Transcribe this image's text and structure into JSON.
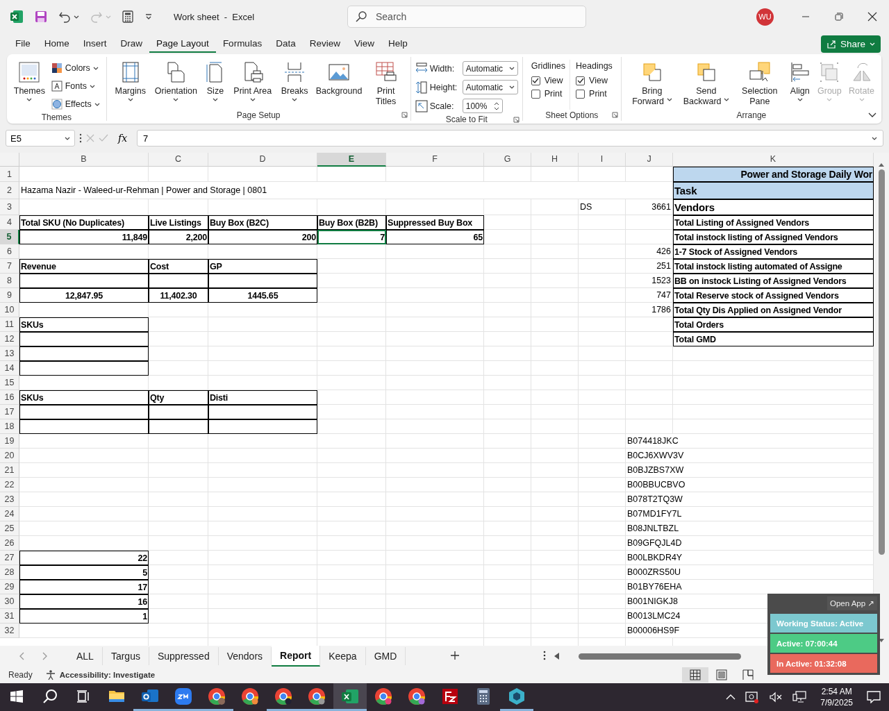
{
  "title_bar": {
    "title": "Work sheet  -  Excel",
    "search": {
      "placeholder": "Search"
    },
    "avatar": "WU"
  },
  "menu": {
    "tabs": [
      {
        "label": "File",
        "selected": false
      },
      {
        "label": "Home",
        "selected": false
      },
      {
        "label": "Insert",
        "selected": false
      },
      {
        "label": "Draw",
        "selected": false
      },
      {
        "label": "Page Layout",
        "selected": true
      },
      {
        "label": "Formulas",
        "selected": false
      },
      {
        "label": "Data",
        "selected": false
      },
      {
        "label": "Review",
        "selected": false
      },
      {
        "label": "View",
        "selected": false
      },
      {
        "label": "Help",
        "selected": false
      }
    ],
    "share": "Share"
  },
  "ribbon": {
    "groups": [
      {
        "label": "Themes",
        "launcher": false,
        "items": [
          {
            "kind": "large",
            "label": "Themes",
            "dropdown": true,
            "disabled": false
          },
          {
            "kind": "small",
            "label": "Colors",
            "dropdown": true,
            "disabled": false
          },
          {
            "kind": "small",
            "label": "Fonts",
            "dropdown": true,
            "disabled": false
          },
          {
            "kind": "small",
            "label": "Effects",
            "dropdown": true,
            "disabled": false
          }
        ]
      },
      {
        "label": "Page Setup",
        "launcher": true,
        "items": [
          {
            "kind": "large",
            "label": "Margins",
            "dropdown": true,
            "disabled": false
          },
          {
            "kind": "large",
            "label": "Orientation",
            "dropdown": true,
            "disabled": false
          },
          {
            "kind": "large",
            "label": "Size",
            "dropdown": true,
            "disabled": false
          },
          {
            "kind": "large",
            "label": "Print Area",
            "dropdown": true,
            "disabled": false
          },
          {
            "kind": "large",
            "label": "Breaks",
            "dropdown": true,
            "disabled": false
          },
          {
            "kind": "large",
            "label": "Background",
            "dropdown": false,
            "disabled": false
          },
          {
            "kind": "large",
            "label": "Print Titles",
            "dropdown": false,
            "disabled": false
          }
        ]
      },
      {
        "label": "Scale to Fit",
        "launcher": true,
        "items": [
          {
            "kind": "field",
            "label": "Width:",
            "value": "Automatic",
            "disabled": false
          },
          {
            "kind": "field",
            "label": "Height:",
            "value": "Automatic",
            "disabled": false
          },
          {
            "kind": "spinner",
            "label": "Scale:",
            "value": "100%",
            "disabled": false
          }
        ]
      },
      {
        "label": "Sheet Options",
        "launcher": true,
        "items": [
          {
            "kind": "options",
            "label": "Gridlines",
            "disabled": false,
            "checks": [
              {
                "label": "View",
                "checked": true
              },
              {
                "label": "Print",
                "checked": false
              }
            ]
          },
          {
            "kind": "options",
            "label": "Headings",
            "disabled": false,
            "checks": [
              {
                "label": "View",
                "checked": true
              },
              {
                "label": "Print",
                "checked": false
              }
            ]
          }
        ]
      },
      {
        "label": "Arrange",
        "launcher": false,
        "items": [
          {
            "kind": "large",
            "label": "Bring Forward",
            "dropdown": true,
            "disabled": false
          },
          {
            "kind": "large",
            "label": "Send Backward",
            "dropdown": true,
            "disabled": false
          },
          {
            "kind": "large",
            "label": "Selection Pane",
            "dropdown": false,
            "disabled": false
          },
          {
            "kind": "large",
            "label": "Align",
            "dropdown": true,
            "disabled": false
          },
          {
            "kind": "large",
            "label": "Group",
            "dropdown": true,
            "disabled": true
          },
          {
            "kind": "large",
            "label": "Rotate",
            "dropdown": true,
            "disabled": true
          }
        ]
      }
    ]
  },
  "formula_bar": {
    "name_box": "E5",
    "function_symbol": "fx",
    "value": "7"
  },
  "sheet": {
    "columns": [
      {
        "label": "B",
        "selected": false
      },
      {
        "label": "C",
        "selected": false
      },
      {
        "label": "D",
        "selected": false
      },
      {
        "label": "E",
        "selected": true
      },
      {
        "label": "F",
        "selected": false
      },
      {
        "label": "G",
        "selected": false
      },
      {
        "label": "H",
        "selected": false
      },
      {
        "label": "I",
        "selected": false
      },
      {
        "label": "J",
        "selected": false
      },
      {
        "label": "K",
        "selected": false
      }
    ],
    "rows": [
      {
        "number": "1",
        "selected": false,
        "cells": [
          null,
          null,
          null,
          null,
          null,
          null,
          null,
          null,
          null,
          {
            "text": "Power and Storage Daily Wor",
            "kind": "title",
            "bold": true,
            "boxed": true,
            "shaded": true
          }
        ]
      },
      {
        "number": "2",
        "selected": false,
        "cells": [
          {
            "text": "Hazama Nazir - Waleed-ur-Rehman | Power and Storage | 0801",
            "kind": "text",
            "bold": false,
            "boxed": false
          },
          null,
          null,
          null,
          null,
          null,
          null,
          null,
          null,
          {
            "text": "Task",
            "kind": "heading",
            "bold": true,
            "boxed": true,
            "shaded": true
          }
        ]
      },
      {
        "number": "3",
        "selected": false,
        "cells": [
          null,
          null,
          null,
          null,
          null,
          null,
          null,
          {
            "text": "DS",
            "kind": "text",
            "bold": false,
            "boxed": false
          },
          {
            "text": "3661",
            "kind": "number",
            "bold": false,
            "boxed": false
          },
          {
            "text": "Vendors",
            "kind": "heading",
            "bold": true,
            "boxed": true,
            "shaded": false
          }
        ]
      },
      {
        "number": "4",
        "selected": false,
        "cells": [
          {
            "text": "Total SKU (No Duplicates)",
            "kind": "text",
            "bold": true,
            "boxed": true
          },
          {
            "text": "Live Listings",
            "kind": "text",
            "bold": true,
            "boxed": true
          },
          {
            "text": "Buy Box (B2C)",
            "kind": "text",
            "bold": true,
            "boxed": true
          },
          {
            "text": "Buy Box (B2B)",
            "kind": "text",
            "bold": true,
            "boxed": true
          },
          {
            "text": "Suppressed Buy Box",
            "kind": "text",
            "bold": true,
            "boxed": true
          },
          null,
          null,
          null,
          null,
          {
            "text": "Total Listing of Assigned Vendors",
            "kind": "text",
            "bold": true,
            "boxed": true,
            "shaded": false
          }
        ]
      },
      {
        "number": "5",
        "selected": true,
        "cells": [
          {
            "text": "11,849",
            "kind": "number",
            "bold": true,
            "boxed": true
          },
          {
            "text": "2,200",
            "kind": "number",
            "bold": true,
            "boxed": true
          },
          {
            "text": "200",
            "kind": "number",
            "bold": true,
            "boxed": true
          },
          {
            "text": "7",
            "kind": "number",
            "bold": true,
            "boxed": true
          },
          {
            "text": "65",
            "kind": "number",
            "bold": true,
            "boxed": true
          },
          null,
          null,
          null,
          null,
          {
            "text": "Total instock listing of Assigned Vendors",
            "kind": "text",
            "bold": true,
            "boxed": true,
            "shaded": false
          }
        ]
      },
      {
        "number": "6",
        "selected": false,
        "cells": [
          null,
          null,
          null,
          null,
          null,
          null,
          null,
          null,
          {
            "text": "426",
            "kind": "number",
            "bold": false,
            "boxed": false
          },
          {
            "text": "1-7 Stock of Assigned Vendors",
            "kind": "text",
            "bold": true,
            "boxed": true,
            "shaded": false
          }
        ]
      },
      {
        "number": "7",
        "selected": false,
        "cells": [
          {
            "text": "Revenue",
            "kind": "text",
            "bold": true,
            "boxed": true
          },
          {
            "text": "Cost",
            "kind": "text",
            "bold": true,
            "boxed": true
          },
          {
            "text": "GP",
            "kind": "text",
            "bold": true,
            "boxed": true
          },
          null,
          null,
          null,
          null,
          null,
          {
            "text": "251",
            "kind": "number",
            "bold": false,
            "boxed": false
          },
          {
            "text": "Total instock listing automated of Assigne",
            "kind": "text",
            "bold": true,
            "boxed": true,
            "shaded": false
          }
        ]
      },
      {
        "number": "8",
        "selected": false,
        "cells": [
          {
            "bold": false,
            "boxed": true
          },
          {
            "bold": false,
            "boxed": true
          },
          {
            "bold": false,
            "boxed": true
          },
          null,
          null,
          null,
          null,
          null,
          {
            "text": "1523",
            "kind": "number",
            "bold": false,
            "boxed": false
          },
          {
            "text": "BB on instock Listing of Assigned Vendors",
            "kind": "text",
            "bold": true,
            "boxed": true,
            "shaded": false
          }
        ]
      },
      {
        "number": "9",
        "selected": false,
        "cells": [
          {
            "text": "12,847.95",
            "kind": "centered",
            "bold": true,
            "boxed": true
          },
          {
            "text": "11,402.30",
            "kind": "centered",
            "bold": true,
            "boxed": true
          },
          {
            "text": "1445.65",
            "kind": "centered",
            "bold": true,
            "boxed": true
          },
          null,
          null,
          null,
          null,
          null,
          {
            "text": "747",
            "kind": "number",
            "bold": false,
            "boxed": false
          },
          {
            "text": "Total Reserve stock of Assigned Vendors",
            "kind": "text",
            "bold": true,
            "boxed": true,
            "shaded": false
          }
        ]
      },
      {
        "number": "10",
        "selected": false,
        "cells": [
          null,
          null,
          null,
          null,
          null,
          null,
          null,
          null,
          {
            "text": "1786",
            "kind": "number",
            "bold": false,
            "boxed": false
          },
          {
            "text": "Total Qty Dis Applied on Assigned Vendor",
            "kind": "text",
            "bold": true,
            "boxed": true,
            "shaded": false
          }
        ]
      },
      {
        "number": "11",
        "selected": false,
        "cells": [
          {
            "text": "SKUs",
            "kind": "text",
            "bold": true,
            "boxed": true
          },
          null,
          null,
          null,
          null,
          null,
          null,
          null,
          null,
          {
            "text": "Total Orders",
            "kind": "text",
            "bold": true,
            "boxed": true,
            "shaded": false
          }
        ]
      },
      {
        "number": "12",
        "selected": false,
        "cells": [
          {
            "bold": false,
            "boxed": true
          },
          null,
          null,
          null,
          null,
          null,
          null,
          null,
          null,
          {
            "text": "Total GMD",
            "kind": "text",
            "bold": true,
            "boxed": true,
            "shaded": false
          }
        ]
      },
      {
        "number": "13",
        "selected": false,
        "cells": [
          {
            "bold": false,
            "boxed": true
          }
        ]
      },
      {
        "number": "14",
        "selected": false,
        "cells": [
          {
            "bold": false,
            "boxed": true
          }
        ]
      },
      {
        "number": "15",
        "selected": false,
        "cells": []
      },
      {
        "number": "16",
        "selected": false,
        "cells": [
          {
            "text": "SKUs",
            "kind": "text",
            "bold": true,
            "boxed": true
          },
          {
            "text": "Qty",
            "kind": "text",
            "bold": true,
            "boxed": true
          },
          {
            "text": "Disti",
            "kind": "text",
            "bold": true,
            "boxed": true
          }
        ]
      },
      {
        "number": "17",
        "selected": false,
        "cells": [
          {
            "bold": false,
            "boxed": true
          },
          {
            "bold": false,
            "boxed": true
          },
          {
            "bold": false,
            "boxed": true
          }
        ]
      },
      {
        "number": "18",
        "selected": false,
        "cells": [
          {
            "bold": false,
            "boxed": true
          },
          {
            "bold": false,
            "boxed": true
          },
          {
            "bold": false,
            "boxed": true
          }
        ]
      },
      {
        "number": "19",
        "selected": false,
        "cells": [
          null,
          null,
          null,
          null,
          null,
          null,
          null,
          null,
          {
            "text": "B074418JKC",
            "kind": "text",
            "bold": false,
            "boxed": false
          }
        ]
      },
      {
        "number": "20",
        "selected": false,
        "cells": [
          null,
          null,
          null,
          null,
          null,
          null,
          null,
          null,
          {
            "text": "B0CJ6XWV3V",
            "kind": "text",
            "bold": false,
            "boxed": false
          }
        ]
      },
      {
        "number": "21",
        "selected": false,
        "cells": [
          null,
          null,
          null,
          null,
          null,
          null,
          null,
          null,
          {
            "text": "B0BJZBS7XW",
            "kind": "text",
            "bold": false,
            "boxed": false
          }
        ]
      },
      {
        "number": "22",
        "selected": false,
        "cells": [
          null,
          null,
          null,
          null,
          null,
          null,
          null,
          null,
          {
            "text": "B00BBUCBVO",
            "kind": "text",
            "bold": false,
            "boxed": false
          }
        ]
      },
      {
        "number": "23",
        "selected": false,
        "cells": [
          null,
          null,
          null,
          null,
          null,
          null,
          null,
          null,
          {
            "text": "B078T2TQ3W",
            "kind": "text",
            "bold": false,
            "boxed": false
          }
        ]
      },
      {
        "number": "24",
        "selected": false,
        "cells": [
          null,
          null,
          null,
          null,
          null,
          null,
          null,
          null,
          {
            "text": "B07MD1FY7L",
            "kind": "text",
            "bold": false,
            "boxed": false
          }
        ]
      },
      {
        "number": "25",
        "selected": false,
        "cells": [
          null,
          null,
          null,
          null,
          null,
          null,
          null,
          null,
          {
            "text": "B08JNLTBZL",
            "kind": "text",
            "bold": false,
            "boxed": false
          }
        ]
      },
      {
        "number": "26",
        "selected": false,
        "cells": [
          null,
          null,
          null,
          null,
          null,
          null,
          null,
          null,
          {
            "text": "B09GFQJL4D",
            "kind": "text",
            "bold": false,
            "boxed": false
          }
        ]
      },
      {
        "number": "27",
        "selected": false,
        "cells": [
          {
            "text": "22",
            "kind": "number",
            "bold": true,
            "boxed": true
          },
          null,
          null,
          null,
          null,
          null,
          null,
          null,
          {
            "text": "B00LBKDR4Y",
            "kind": "text",
            "bold": false,
            "boxed": false
          }
        ]
      },
      {
        "number": "28",
        "selected": false,
        "cells": [
          {
            "text": "5",
            "kind": "number",
            "bold": true,
            "boxed": true
          },
          null,
          null,
          null,
          null,
          null,
          null,
          null,
          {
            "text": "B000ZRS50U",
            "kind": "text",
            "bold": false,
            "boxed": false
          }
        ]
      },
      {
        "number": "29",
        "selected": false,
        "cells": [
          {
            "text": "17",
            "kind": "number",
            "bold": true,
            "boxed": true
          },
          null,
          null,
          null,
          null,
          null,
          null,
          null,
          {
            "text": "B01BY76EHA",
            "kind": "text",
            "bold": false,
            "boxed": false
          }
        ]
      },
      {
        "number": "30",
        "selected": false,
        "cells": [
          {
            "text": "16",
            "kind": "number",
            "bold": true,
            "boxed": true
          },
          null,
          null,
          null,
          null,
          null,
          null,
          null,
          {
            "text": "B001NIGKJ8",
            "kind": "text",
            "bold": false,
            "boxed": false
          }
        ]
      },
      {
        "number": "31",
        "selected": false,
        "cells": [
          {
            "text": "1",
            "kind": "number",
            "bold": true,
            "boxed": true
          },
          null,
          null,
          null,
          null,
          null,
          null,
          null,
          {
            "text": "B0013LMC24",
            "kind": "text",
            "bold": false,
            "boxed": false
          }
        ]
      },
      {
        "number": "32",
        "selected": false,
        "cells": [
          null,
          null,
          null,
          null,
          null,
          null,
          null,
          null,
          {
            "text": "B00006HS9F",
            "kind": "text",
            "bold": false,
            "boxed": false
          }
        ]
      }
    ]
  },
  "sheet_tabs": [
    {
      "label": "ALL",
      "selected": false
    },
    {
      "label": "Targus",
      "selected": false
    },
    {
      "label": "Suppressed",
      "selected": false
    },
    {
      "label": "Vendors",
      "selected": false
    },
    {
      "label": "Report",
      "selected": true
    },
    {
      "label": "Keepa",
      "selected": false
    },
    {
      "label": "GMD",
      "selected": false
    }
  ],
  "status_bar": {
    "mode": "Ready",
    "accessibility": "Accessibility: Investigate",
    "views": [
      {
        "selected": true
      },
      {
        "selected": false
      },
      {
        "selected": false
      }
    ]
  },
  "tracker": {
    "open_app": "Open App ↗",
    "rows": [
      {
        "text": "Working Status: Active",
        "color": "#7cc8cf"
      },
      {
        "text": "Active: 07:00:44",
        "color": "#4dcb85"
      },
      {
        "text": "In Active: 01:32:08",
        "color": "#e9695d"
      }
    ]
  },
  "taskbar": {
    "apps": [
      {
        "running": false,
        "selected": false
      },
      {
        "running": true,
        "selected": false
      },
      {
        "running": true,
        "selected": false
      },
      {
        "running": true,
        "selected": false
      },
      {
        "running": false,
        "selected": false
      },
      {
        "running": true,
        "selected": false
      },
      {
        "running": true,
        "selected": false
      },
      {
        "running": true,
        "selected": true
      },
      {
        "running": false,
        "selected": false
      },
      {
        "running": false,
        "selected": false
      },
      {
        "running": false,
        "selected": false
      },
      {
        "running": false,
        "selected": false
      },
      {
        "running": true,
        "selected": false
      }
    ],
    "time": "2:54 AM",
    "date": "7/9/2025"
  }
}
